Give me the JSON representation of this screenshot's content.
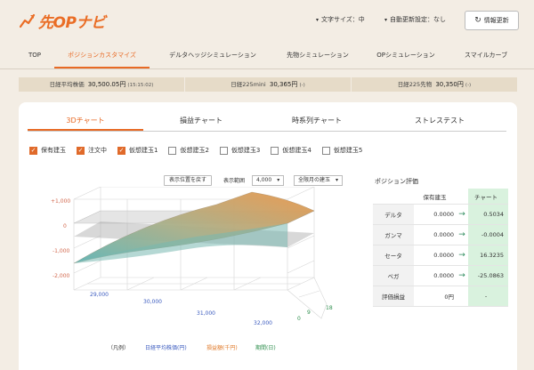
{
  "header": {
    "logo_text": "先OPナビ",
    "font_size_label": "文字サイズ：中",
    "auto_update_label": "自動更新設定：なし",
    "refresh_label": "情報更新"
  },
  "nav": [
    "TOP",
    "ポジションカスタマイズ",
    "デルタヘッジシミュレーション",
    "先物シミュレーション",
    "OPシミュレーション",
    "スマイルカーブ"
  ],
  "ticker": [
    {
      "label": "日経平均株価",
      "value": "30,500.05円",
      "note": "(15:15:02)"
    },
    {
      "label": "日経225mini",
      "value": "30,365円",
      "note": "(-)"
    },
    {
      "label": "日経225先物",
      "value": "30,350円",
      "note": "(-)"
    }
  ],
  "tabs": [
    "3Dチャート",
    "損益チャート",
    "時系列チャート",
    "ストレステスト"
  ],
  "checkboxes": [
    {
      "label": "保有建玉",
      "checked": true
    },
    {
      "label": "注文中",
      "checked": true
    },
    {
      "label": "仮想建玉1",
      "checked": true
    },
    {
      "label": "仮想建玉2",
      "checked": false
    },
    {
      "label": "仮想建玉3",
      "checked": false
    },
    {
      "label": "仮想建玉4",
      "checked": false
    },
    {
      "label": "仮想建玉5",
      "checked": false
    }
  ],
  "controls": {
    "reset_view": "表示位置を戻す",
    "range_label": "表示範囲",
    "range_value": "4,000",
    "month_value": "全限月の建玉"
  },
  "chart": {
    "z_ticks": [
      "+1,000",
      "0",
      "-1,000",
      "-2,000"
    ],
    "x_ticks": [
      "29,000",
      "30,000",
      "31,000",
      "32,000"
    ],
    "y_ticks": [
      "0",
      "9",
      "18"
    ]
  },
  "legend": {
    "title": "（凡例）",
    "x_label": "日経平均株価(円)",
    "z_label": "損益額(千円)",
    "y_label": "期間(日)",
    "x_color": "#3b5bbf",
    "z_color": "#e07a2a",
    "y_color": "#2f8f4e"
  },
  "evaluation": {
    "title": "ポジション評価",
    "col_hold": "保有建玉",
    "col_chart": "チャート",
    "rows": [
      {
        "label": "デルタ",
        "hold": "0.0000",
        "chart": "0.5034"
      },
      {
        "label": "ガンマ",
        "hold": "0.0000",
        "chart": "-0.0004"
      },
      {
        "label": "セータ",
        "hold": "0.0000",
        "chart": "16.3235"
      },
      {
        "label": "ベガ",
        "hold": "0.0000",
        "chart": "-25.0863"
      },
      {
        "label": "評価損益",
        "hold": "0円",
        "chart": "-"
      }
    ]
  },
  "colors": {
    "accent": "#e86a25",
    "surface_orange": "#e8964a",
    "surface_teal": "#5fb3b3",
    "positive_bg": "#d9f2de"
  }
}
